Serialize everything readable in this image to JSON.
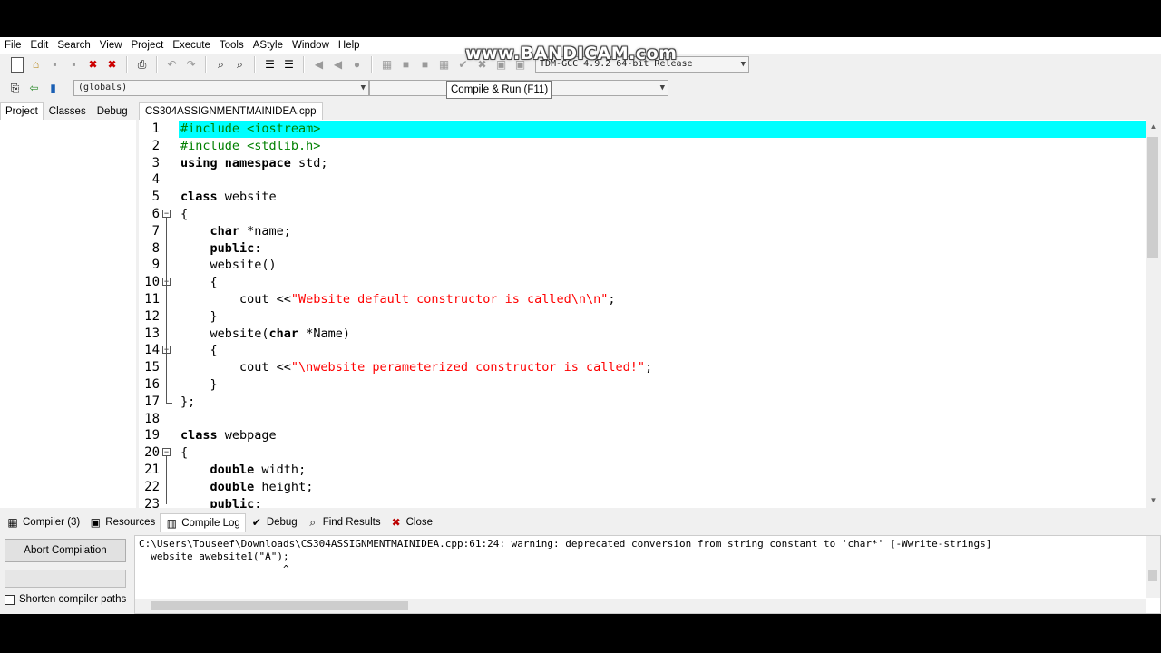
{
  "menu": [
    "File",
    "Edit",
    "Search",
    "View",
    "Project",
    "Execute",
    "Tools",
    "AStyle",
    "Window",
    "Help"
  ],
  "watermark": "www.BANDICAM.com",
  "toolbar": {
    "compiler_select": "TDM-GCC 4.9.2 64-bit Release",
    "globals_select": "(globals)",
    "tooltip": "Compile & Run (F11)"
  },
  "left_tabs": [
    "Project",
    "Classes",
    "Debug"
  ],
  "editor": {
    "file_tab": "CS304ASSIGNMENTMAINIDEA.cpp",
    "highlight_color": "#00ffff",
    "line_numbers": [
      "1",
      "2",
      "3",
      "4",
      "5",
      "6",
      "7",
      "8",
      "9",
      "10",
      "11",
      "12",
      "13",
      "14",
      "15",
      "16",
      "17",
      "18",
      "19",
      "20",
      "21",
      "22",
      "23"
    ],
    "lines": [
      [
        {
          "t": "#include <iostream>",
          "c": "pp"
        }
      ],
      [
        {
          "t": "#include <stdlib.h>",
          "c": "pp"
        }
      ],
      [
        {
          "t": "using namespace",
          "c": "kw"
        },
        {
          "t": " std;",
          "c": ""
        }
      ],
      [],
      [
        {
          "t": "class",
          "c": "kw"
        },
        {
          "t": " website",
          "c": ""
        }
      ],
      [
        {
          "t": "{",
          "c": ""
        }
      ],
      [
        {
          "t": "    ",
          "c": ""
        },
        {
          "t": "char",
          "c": "kw"
        },
        {
          "t": " *name;",
          "c": ""
        }
      ],
      [
        {
          "t": "    ",
          "c": ""
        },
        {
          "t": "public",
          "c": "kw"
        },
        {
          "t": ":",
          "c": ""
        }
      ],
      [
        {
          "t": "    website()",
          "c": ""
        }
      ],
      [
        {
          "t": "    {",
          "c": ""
        }
      ],
      [
        {
          "t": "        cout <<",
          "c": ""
        },
        {
          "t": "\"Website default constructor is called\\n\\n\"",
          "c": "str"
        },
        {
          "t": ";",
          "c": ""
        }
      ],
      [
        {
          "t": "    }",
          "c": ""
        }
      ],
      [
        {
          "t": "    website(",
          "c": ""
        },
        {
          "t": "char",
          "c": "kw"
        },
        {
          "t": " *Name)",
          "c": ""
        }
      ],
      [
        {
          "t": "    {",
          "c": ""
        }
      ],
      [
        {
          "t": "        cout <<",
          "c": ""
        },
        {
          "t": "\"\\nwebsite perameterized constructor is called!\"",
          "c": "str"
        },
        {
          "t": ";",
          "c": ""
        }
      ],
      [
        {
          "t": "    }",
          "c": ""
        }
      ],
      [
        {
          "t": "};",
          "c": ""
        }
      ],
      [],
      [
        {
          "t": "class",
          "c": "kw"
        },
        {
          "t": " webpage",
          "c": ""
        }
      ],
      [
        {
          "t": "{",
          "c": ""
        }
      ],
      [
        {
          "t": "    ",
          "c": ""
        },
        {
          "t": "double",
          "c": "kw"
        },
        {
          "t": " width;",
          "c": ""
        }
      ],
      [
        {
          "t": "    ",
          "c": ""
        },
        {
          "t": "double",
          "c": "kw"
        },
        {
          "t": " height;",
          "c": ""
        }
      ],
      [
        {
          "t": "    ",
          "c": ""
        },
        {
          "t": "public",
          "c": "kw"
        },
        {
          "t": ":",
          "c": ""
        }
      ]
    ]
  },
  "bottom_tabs": [
    {
      "label": "Compiler (3)",
      "icon": "grid-icon",
      "glyph": "▦"
    },
    {
      "label": "Resources",
      "icon": "resources-icon",
      "glyph": "▣"
    },
    {
      "label": "Compile Log",
      "icon": "chart-icon",
      "glyph": "▥"
    },
    {
      "label": "Debug",
      "icon": "check-icon",
      "glyph": "✔"
    },
    {
      "label": "Find Results",
      "icon": "find-icon",
      "glyph": "⌕"
    },
    {
      "label": "Close",
      "icon": "close-icon",
      "glyph": "✖"
    }
  ],
  "compile_panel": {
    "abort_button": "Abort Compilation",
    "shorten_paths": "Shorten compiler paths",
    "log_lines": [
      "C:\\Users\\Touseef\\Downloads\\CS304ASSIGNMENTMAINIDEA.cpp:61:24: warning: deprecated conversion from string constant to 'char*' [-Wwrite-strings]",
      "  website awebsite1(\"A\");",
      "                        ^"
    ]
  }
}
